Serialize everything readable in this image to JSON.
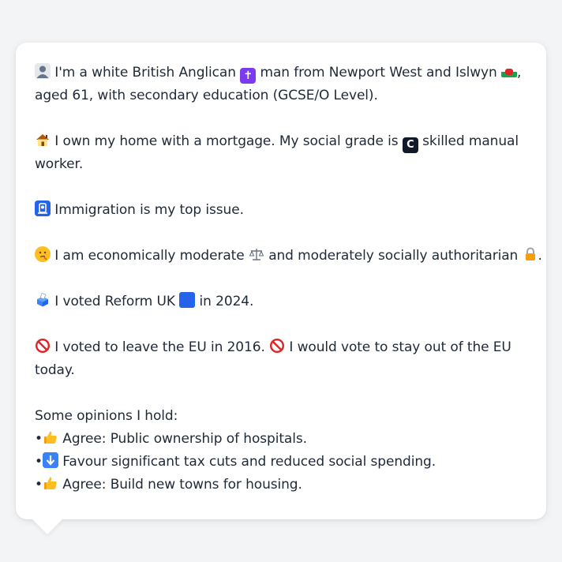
{
  "profile": {
    "line1a": " I'm a white British Anglican ",
    "line1b": " man from Newport West and Islwyn ",
    "line1c": ",",
    "line1d": "aged 61, with secondary education (GCSE/O Level).",
    "line2a": " I own my home with a mortgage. My social grade is ",
    "line2b": " skilled manual",
    "line2c": "worker.",
    "line3": " Immigration is my top issue.",
    "line4a": " I am economically moderate ",
    "line4b": " and moderately socially authoritarian ",
    "line4c": ".",
    "line5a": " I voted Reform UK ",
    "line5b": " in 2024.",
    "line6a": " I voted to leave the EU in 2016. ",
    "line6b": " I would vote to stay out of the EU",
    "line6c": "today."
  },
  "opinions": {
    "heading": "Some opinions I hold:",
    "items": [
      {
        "text": " Agree: Public ownership of hospitals.",
        "icon": "thumbs-up-icon"
      },
      {
        "text": " Favour significant tax cuts and reduced social spending.",
        "icon": "down-arrow-icon"
      },
      {
        "text": " Agree: Build new towns for housing.",
        "icon": "thumbs-up-icon"
      }
    ],
    "bullet": "•"
  },
  "icons": {
    "grade_letter": "C",
    "cross_glyph": "✝",
    "passport_glyph": "🛂",
    "down_glyph": "⬇",
    "thinking_glyph": "?",
    "scales_glyph": "⚖"
  },
  "colors": {
    "background": "#f3f4f6",
    "bubble": "#ffffff",
    "text": "#1f2937",
    "reform_blue": "#2563eb"
  }
}
